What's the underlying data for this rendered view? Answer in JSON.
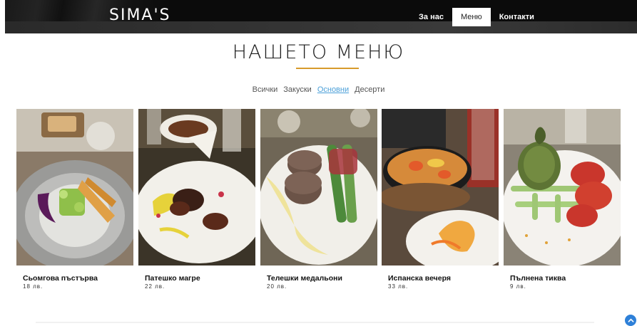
{
  "header": {
    "brand": "SIMA'S",
    "nav": [
      {
        "label": "За нас",
        "active": false
      },
      {
        "label": "Меню",
        "active": true
      },
      {
        "label": "Контакти",
        "active": false
      }
    ]
  },
  "menu": {
    "title": "НАШЕТО МЕНЮ",
    "filters": [
      {
        "label": "Всички",
        "active": false
      },
      {
        "label": "Закуски",
        "active": false
      },
      {
        "label": "Основни",
        "active": true
      },
      {
        "label": "Десерти",
        "active": false
      }
    ],
    "dishes": [
      {
        "name": "Сьомгова пъстърва",
        "price": "18 лв."
      },
      {
        "name": "Патешко магре",
        "price": "22 лв."
      },
      {
        "name": "Телешки медальони",
        "price": "20 лв."
      },
      {
        "name": "Испанска вечеря",
        "price": "33 лв."
      },
      {
        "name": "Пълнена тиква",
        "price": "9 лв."
      }
    ]
  },
  "colors": {
    "accent_rule": "#d79a2b",
    "active_filter": "#4a9fd8",
    "scroll_button": "#2e80d8"
  },
  "icons": {
    "scroll_top": "chevron-up-icon"
  }
}
